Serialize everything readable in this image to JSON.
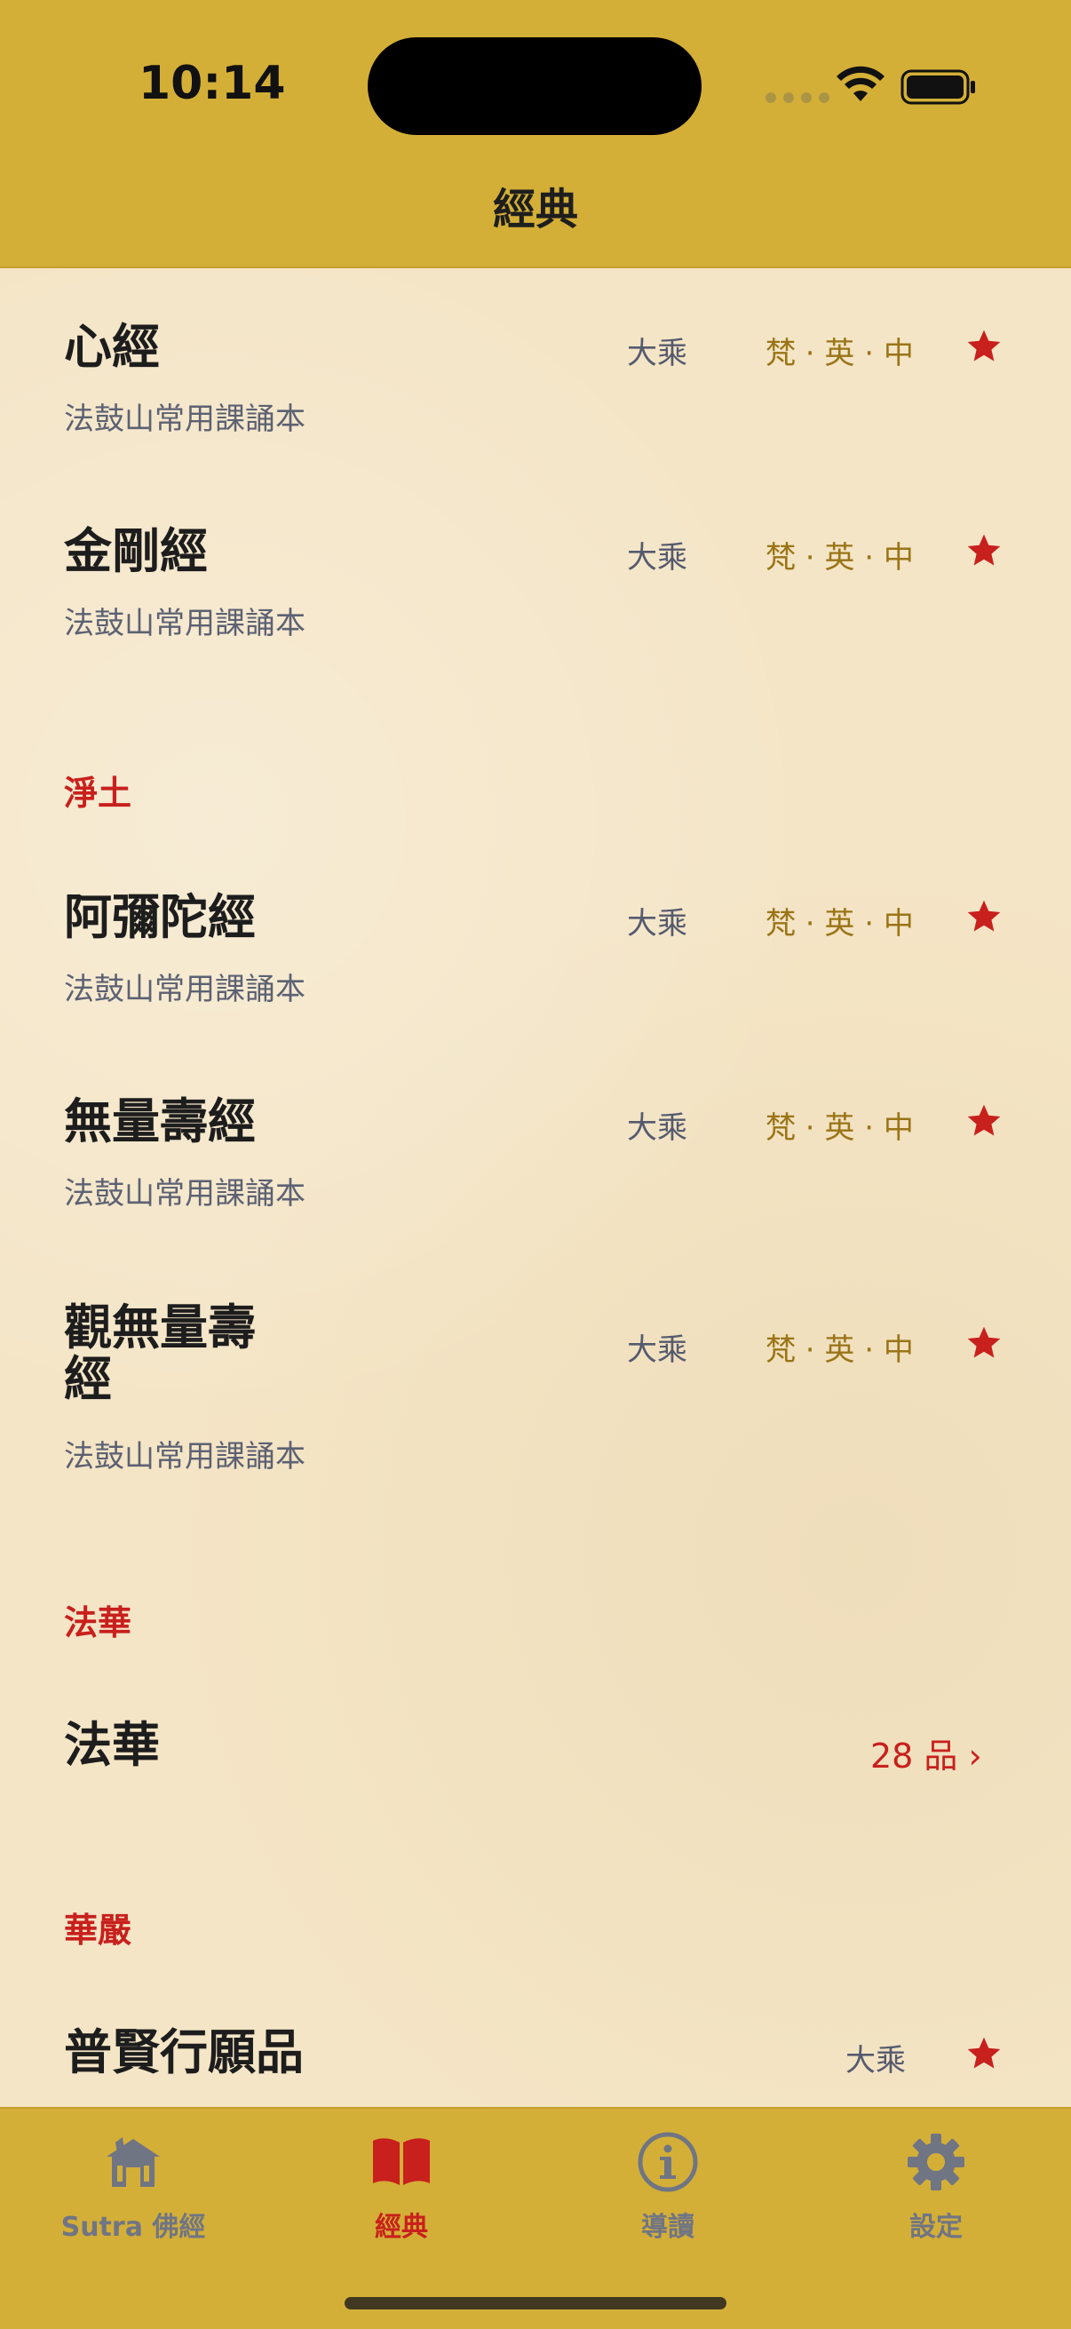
{
  "status": {
    "time": "10:14"
  },
  "nav": {
    "title": "經典"
  },
  "items": [
    {
      "title": "心經",
      "subtitle": "法鼓山常用課誦本",
      "school": "大乘",
      "languages": "梵 · 英 · 中",
      "favorite": true
    },
    {
      "title": "金剛經",
      "subtitle": "法鼓山常用課誦本",
      "school": "大乘",
      "languages": "梵 · 英 · 中",
      "favorite": true
    },
    {
      "title": "阿彌陀經",
      "subtitle": "法鼓山常用課誦本",
      "school": "大乘",
      "languages": "梵 · 英 · 中",
      "favorite": true
    },
    {
      "title": "無量壽經",
      "subtitle": "法鼓山常用課誦本",
      "school": "大乘",
      "languages": "梵 · 英 · 中",
      "favorite": true
    },
    {
      "title_line1": "觀無量壽",
      "title_line2": "經",
      "subtitle": "法鼓山常用課誦本",
      "school": "大乘",
      "languages": "梵 · 英 · 中",
      "favorite": true
    }
  ],
  "sections": {
    "pure_land": "淨土",
    "lotus": "法華",
    "avatamsaka": "華嚴"
  },
  "lotus_row": {
    "title": "法華",
    "count": "28 品 ›"
  },
  "avatamsaka_row": {
    "title": "普賢行願品",
    "school": "大乘",
    "favorite": true
  },
  "tabs": [
    {
      "label": "Sutra 佛經",
      "icon": "temple-icon",
      "active": false
    },
    {
      "label": "經典",
      "icon": "book-icon",
      "active": true
    },
    {
      "label": "導讀",
      "icon": "info-icon",
      "active": false
    },
    {
      "label": "設定",
      "icon": "gear-icon",
      "active": false
    }
  ],
  "colors": {
    "header_bg": "#d4af37",
    "paper_bg": "#f4e5c6",
    "accent_red": "#c8201d",
    "lang_gold": "#9a7417",
    "muted": "#5c6173"
  }
}
